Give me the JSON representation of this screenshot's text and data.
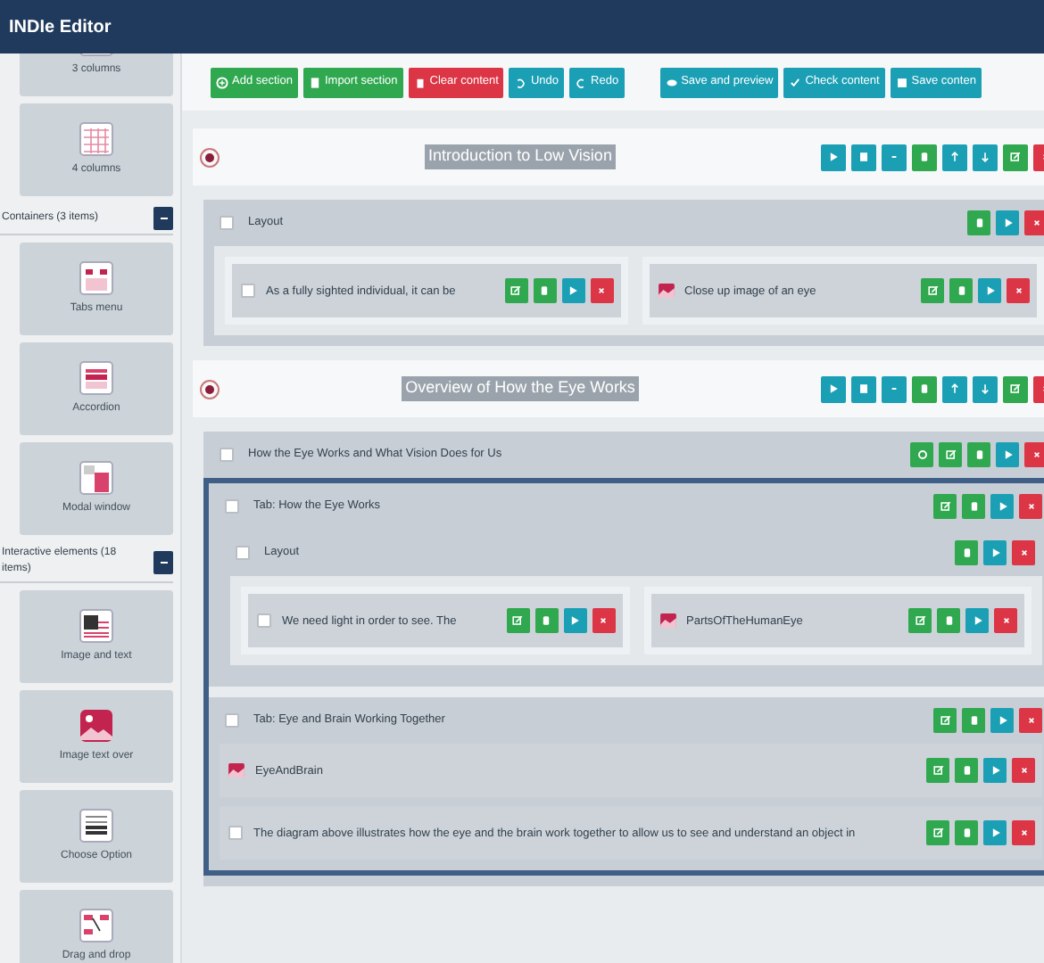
{
  "app": {
    "title": "INDIe Editor"
  },
  "sidebar": [
    {
      "kind": "columns3",
      "label": "3 columns"
    },
    {
      "kind": "columns4",
      "label": "4 columns"
    },
    {
      "kind": "group",
      "label": "Containers (3 items)",
      "expanded": true
    },
    {
      "kind": "tabs",
      "label": "Tabs menu"
    },
    {
      "kind": "accordion",
      "label": "Accordion"
    },
    {
      "kind": "modal",
      "label": "Modal window"
    },
    {
      "kind": "group",
      "label": "Interactive elements (18 items)",
      "expanded": true
    },
    {
      "kind": "imagetext",
      "label": "Image and text"
    },
    {
      "kind": "imageover",
      "label": "Image text over"
    },
    {
      "kind": "choose",
      "label": "Choose Option"
    },
    {
      "kind": "drag",
      "label": "Drag and drop"
    }
  ],
  "toolbar": {
    "left": [
      {
        "kind": "add",
        "label": "Add section"
      },
      {
        "kind": "import",
        "label": "Import section"
      },
      {
        "kind": "clear",
        "label": "Clear content"
      },
      {
        "kind": "undo",
        "label": "Undo"
      },
      {
        "kind": "redo",
        "label": "Redo"
      }
    ],
    "right": [
      {
        "kind": "preview",
        "label": "Save and preview"
      },
      {
        "kind": "check",
        "label": "Check content"
      },
      {
        "kind": "save",
        "label": "Save conten"
      }
    ]
  },
  "content": [
    {
      "kind": "section",
      "title": "Introduction to Low Vision",
      "selected": true,
      "actions": [
        {
          "kind": "view"
        },
        {
          "kind": "copy"
        },
        {
          "kind": "minus"
        },
        {
          "kind": "paste"
        },
        {
          "kind": "up"
        },
        {
          "kind": "down"
        },
        {
          "kind": "edit"
        },
        {
          "kind": "delete"
        }
      ]
    },
    {
      "kind": "container",
      "label": "Layout",
      "checked": false,
      "actions": [
        {
          "kind": "paste"
        },
        {
          "kind": "view"
        },
        {
          "kind": "delete"
        }
      ],
      "children": [
        {
          "kind": "columns",
          "columns": [
            [
              {
                "kind": "text",
                "text": "As a fully sighted individual, it can be",
                "checked": false,
                "actions": [
                  {
                    "kind": "edit"
                  },
                  {
                    "kind": "paste"
                  },
                  {
                    "kind": "view"
                  },
                  {
                    "kind": "delete"
                  }
                ]
              }
            ],
            [
              {
                "kind": "image",
                "text": "Close up image of an eye",
                "actions": [
                  {
                    "kind": "edit"
                  },
                  {
                    "kind": "paste"
                  },
                  {
                    "kind": "view"
                  },
                  {
                    "kind": "delete"
                  }
                ]
              }
            ]
          ]
        }
      ]
    },
    {
      "kind": "section",
      "title": "Overview of How the Eye Works",
      "selected": true,
      "actions": [
        {
          "kind": "view"
        },
        {
          "kind": "copy"
        },
        {
          "kind": "minus"
        },
        {
          "kind": "paste"
        },
        {
          "kind": "up"
        },
        {
          "kind": "down"
        },
        {
          "kind": "edit"
        },
        {
          "kind": "delete"
        }
      ]
    },
    {
      "kind": "container",
      "label": "How the Eye Works and What Vision Does for Us",
      "checked": false,
      "actions": [
        {
          "kind": "settings"
        },
        {
          "kind": "edit"
        },
        {
          "kind": "paste"
        },
        {
          "kind": "view"
        },
        {
          "kind": "delete"
        }
      ],
      "children": [
        {
          "kind": "tabs",
          "children": [
            {
              "kind": "container",
              "label": "Tab: How the Eye Works",
              "checked": false,
              "actions": [
                {
                  "kind": "edit"
                },
                {
                  "kind": "paste"
                },
                {
                  "kind": "view"
                },
                {
                  "kind": "delete"
                }
              ],
              "children": [
                {
                  "kind": "container",
                  "label": "Layout",
                  "checked": false,
                  "actions": [
                    {
                      "kind": "paste"
                    },
                    {
                      "kind": "view"
                    },
                    {
                      "kind": "delete"
                    }
                  ],
                  "children": [
                    {
                      "kind": "columns",
                      "columns": [
                        [
                          {
                            "kind": "text",
                            "text": "We need light in order to see. The",
                            "checked": false,
                            "actions": [
                              {
                                "kind": "edit"
                              },
                              {
                                "kind": "paste"
                              },
                              {
                                "kind": "view"
                              },
                              {
                                "kind": "delete"
                              }
                            ]
                          }
                        ],
                        [
                          {
                            "kind": "image",
                            "text": "PartsOfTheHumanEye",
                            "actions": [
                              {
                                "kind": "edit"
                              },
                              {
                                "kind": "paste"
                              },
                              {
                                "kind": "view"
                              },
                              {
                                "kind": "delete"
                              }
                            ]
                          }
                        ]
                      ]
                    }
                  ]
                }
              ]
            },
            {
              "kind": "container",
              "label": "Tab: Eye and Brain Working Together",
              "checked": false,
              "actions": [
                {
                  "kind": "edit"
                },
                {
                  "kind": "paste"
                },
                {
                  "kind": "view"
                },
                {
                  "kind": "delete"
                }
              ],
              "children": [
                {
                  "kind": "image",
                  "text": "EyeAndBrain",
                  "actions": [
                    {
                      "kind": "edit"
                    },
                    {
                      "kind": "paste"
                    },
                    {
                      "kind": "view"
                    },
                    {
                      "kind": "delete"
                    }
                  ]
                },
                {
                  "kind": "text",
                  "text": "The diagram above illustrates how the eye and the brain work together to allow us to see and understand an object in",
                  "checked": false,
                  "actions": [
                    {
                      "kind": "edit"
                    },
                    {
                      "kind": "paste"
                    },
                    {
                      "kind": "view"
                    },
                    {
                      "kind": "delete"
                    }
                  ]
                }
              ]
            }
          ]
        }
      ]
    }
  ]
}
